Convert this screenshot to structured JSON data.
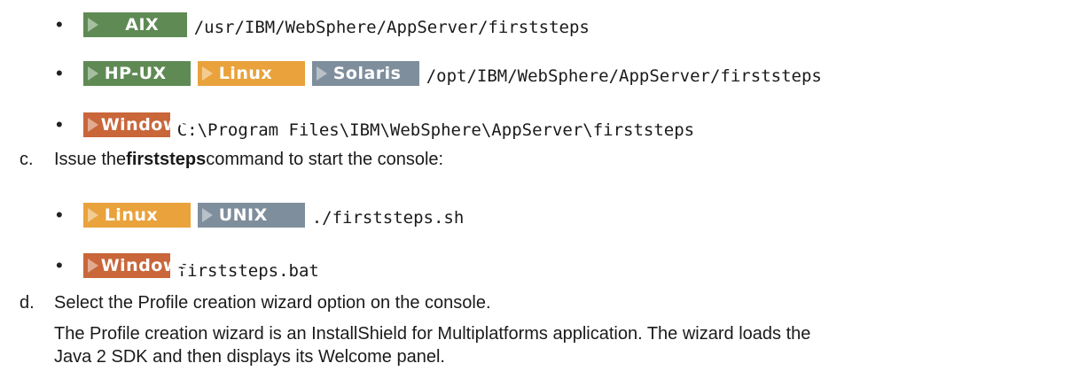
{
  "colors": {
    "aix": "#5f8a54",
    "hpux": "#5f8a54",
    "linux": "#e9a23c",
    "solaris": "#7f8e9c",
    "windows": "#c9663a",
    "unix": "#7f8e9c"
  },
  "paths": [
    {
      "badges": [
        {
          "label": "AIX",
          "key": "aix"
        }
      ],
      "path": "/usr/IBM/WebSphere/AppServer/firststeps"
    },
    {
      "badges": [
        {
          "label": "HP-UX",
          "key": "hpux"
        },
        {
          "label": "Linux",
          "key": "linux"
        },
        {
          "label": "Solaris",
          "key": "solaris"
        }
      ],
      "path": "/opt/IBM/WebSphere/AppServer/firststeps"
    },
    {
      "badges": [
        {
          "label": "Windows",
          "key": "windows"
        }
      ],
      "path": "C:\\Program Files\\IBM\\WebSphere\\AppServer\\firststeps"
    }
  ],
  "step_c": {
    "letter": "c.",
    "text_before": "Issue the ",
    "command": "firststeps",
    "text_after": " command to start the console:"
  },
  "commands": [
    {
      "badges": [
        {
          "label": "Linux",
          "key": "linux"
        },
        {
          "label": "UNIX",
          "key": "unix"
        }
      ],
      "cmd": "./firststeps.sh"
    },
    {
      "badges": [
        {
          "label": "Windows",
          "key": "windows"
        }
      ],
      "cmd": "firststeps.bat"
    }
  ],
  "step_d": {
    "letter": "d.",
    "text": "Select the Profile creation wizard option on the console.",
    "para_line1": "The Profile creation wizard is an InstallShield for Multiplatforms application. The wizard loads the",
    "para_line2": "Java 2 SDK and then displays its Welcome panel."
  }
}
